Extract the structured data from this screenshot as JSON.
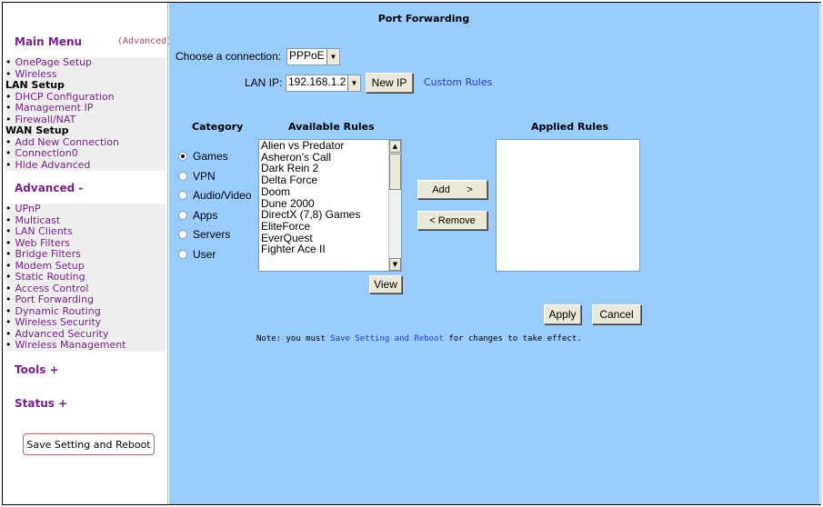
{
  "sidebar": {
    "main_menu": "Main Menu",
    "advanced_tag": "(Advanced)",
    "onepage": "OnePage Setup",
    "wireless": "Wireless",
    "lan_setup": "LAN Setup",
    "dhcp": "DHCP Configuration",
    "management_ip": "Management IP",
    "firewall": "Firewall/NAT",
    "wan_setup": "WAN Setup",
    "add_connection": "Add New Connection",
    "connection0": "Connection0",
    "hide_advanced": "Hide Advanced",
    "advanced_header": "Advanced -",
    "advanced_items": [
      "UPnP",
      "Multicast",
      "LAN Clients",
      "Web Filters",
      "Bridge Filters",
      "Modem Setup",
      "Static Routing",
      "Access Control",
      "Port Forwarding",
      "Dynamic Routing",
      "Wireless Security",
      "Advanced Security",
      "Wireless Management"
    ],
    "tools": "Tools +",
    "status": "Status +",
    "save_reboot_button": "Save Setting and Reboot"
  },
  "main": {
    "title": "Port Forwarding",
    "choose_connection_label": "Choose a connection:",
    "connection_value": "PPPoE",
    "lan_ip_label": "LAN IP:",
    "lan_ip_value": "192.168.1.2",
    "new_ip_button": "New IP",
    "custom_rules_link": "Custom Rules",
    "category_header": "Category",
    "available_header": "Available Rules",
    "applied_header": "Applied Rules",
    "categories": [
      "Games",
      "VPN",
      "Audio/Video",
      "Apps",
      "Servers",
      "User"
    ],
    "selected_category": "Games",
    "available_rules": [
      "Alien vs Predator",
      "Asheron's Call",
      "Dark Rein 2",
      "Delta Force",
      "Doom",
      "Dune 2000",
      "DirectX (7,8) Games",
      "EliteForce",
      "EverQuest",
      "Fighter Ace II"
    ],
    "add_button": "Add      >",
    "remove_button": "< Remove",
    "view_button": "View",
    "apply_button": "Apply",
    "cancel_button": "Cancel",
    "note_prefix": "Note: you must ",
    "note_link": "Save Setting and Reboot",
    "note_suffix": " for changes to take effect."
  },
  "colors": {
    "main_bg": "#99ccff",
    "link": "#7b1f8e",
    "blue_link": "#1f3fbf"
  }
}
